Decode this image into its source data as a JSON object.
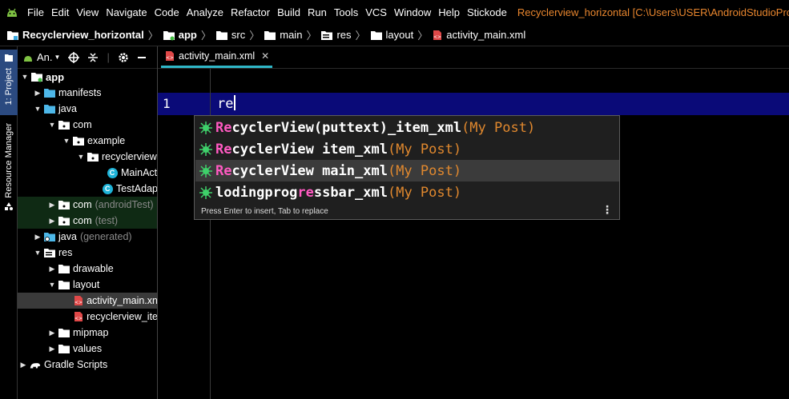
{
  "menu": {
    "items": [
      {
        "label": "File"
      },
      {
        "label": "Edit"
      },
      {
        "label": "View"
      },
      {
        "label": "Navigate"
      },
      {
        "label": "Code"
      },
      {
        "label": "Analyze"
      },
      {
        "label": "Refactor"
      },
      {
        "label": "Build"
      },
      {
        "label": "Run"
      },
      {
        "label": "Tools"
      },
      {
        "label": "VCS"
      },
      {
        "label": "Window"
      },
      {
        "label": "Help"
      },
      {
        "label": "Stickode"
      }
    ],
    "window_title": "Recyclerview_horizontal [C:\\Users\\USER\\AndroidStudioProje"
  },
  "breadcrumb": {
    "items": [
      "Recyclerview_horizontal",
      "app",
      "src",
      "main",
      "res",
      "layout",
      "activity_main.xml"
    ]
  },
  "sidebar_strip": {
    "project_tab": "1: Project",
    "resource_tab": "Resource Manager"
  },
  "project_panel": {
    "view_selector": "An.",
    "tree": [
      {
        "label": "app",
        "muted": ""
      },
      {
        "label": "manifests",
        "muted": ""
      },
      {
        "label": "java",
        "muted": ""
      },
      {
        "label": "com",
        "muted": ""
      },
      {
        "label": "example",
        "muted": ""
      },
      {
        "label": "recyclerview",
        "muted": ""
      },
      {
        "label": "MainAct",
        "muted": ""
      },
      {
        "label": "TestAdap",
        "muted": ""
      },
      {
        "label": "com",
        "muted": "(androidTest)"
      },
      {
        "label": "com",
        "muted": "(test)"
      },
      {
        "label": "java",
        "muted": "(generated)"
      },
      {
        "label": "res",
        "muted": ""
      },
      {
        "label": "drawable",
        "muted": ""
      },
      {
        "label": "layout",
        "muted": ""
      },
      {
        "label": "activity_main.xn",
        "muted": ""
      },
      {
        "label": "recyclerview_ite",
        "muted": ""
      },
      {
        "label": "mipmap",
        "muted": ""
      },
      {
        "label": "values",
        "muted": ""
      },
      {
        "label": "Gradle Scripts",
        "muted": ""
      }
    ]
  },
  "editor": {
    "tab_label": "activity_main.xml",
    "line_number": "1",
    "typed_text": "re"
  },
  "completion": {
    "items": [
      {
        "pre": "",
        "hl": "Re",
        "post": "cyclerView(puttext)_item_xml",
        "source": "(My Post)"
      },
      {
        "pre": "",
        "hl": "Re",
        "post": "cyclerView item_xml",
        "source": "(My Post)"
      },
      {
        "pre": "",
        "hl": "Re",
        "post": "cyclerView main_xml",
        "source": "(My Post)"
      },
      {
        "pre": "lodingprog",
        "hl": "re",
        "post": "ssbar_xml",
        "source": "(My Post)"
      }
    ],
    "footer": "Press Enter to insert, Tab to replace"
  },
  "colors": {
    "accent_tab_underline": "#2fb6c7",
    "current_line": "#0a0a78",
    "match_highlight": "#ff5ac2",
    "source_label": "#e0882e",
    "window_title": "#e8862e"
  }
}
